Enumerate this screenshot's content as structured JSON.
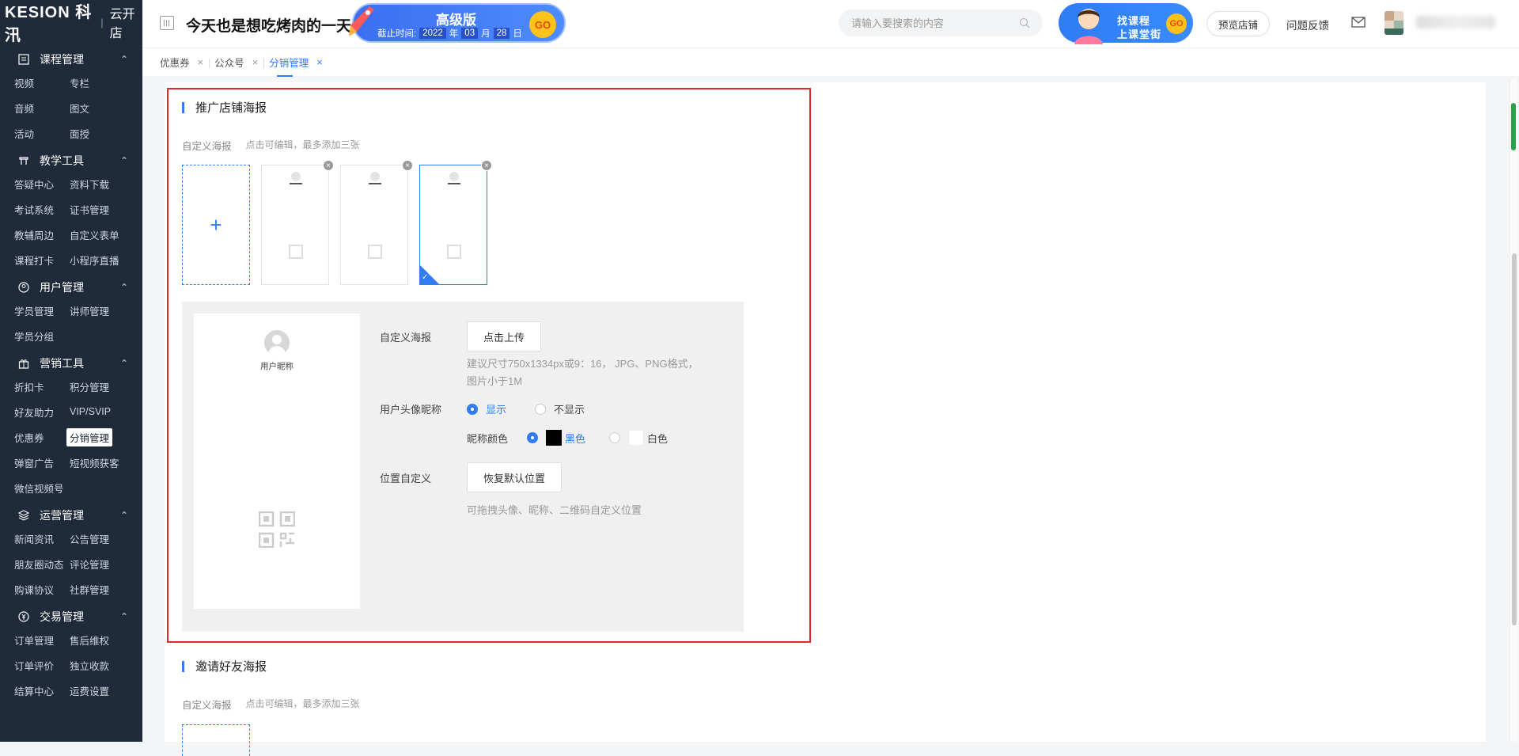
{
  "brand": {
    "name": "KESION 科汛",
    "shop": "云开店"
  },
  "header": {
    "slogan": "今天也是想吃烤肉的一天",
    "badge": {
      "level": "高级版",
      "expire_label": "截止时间:",
      "year": "2022",
      "year_unit": "年",
      "month": "03",
      "month_unit": "月",
      "day": "28",
      "day_unit": "日",
      "go": "GO"
    },
    "search_placeholder": "请输入要搜索的内容",
    "promo": {
      "line1": "找课程",
      "line2": "上课堂街",
      "go": "GO"
    },
    "preview_shop": "预览店铺",
    "feedback": "问题反馈"
  },
  "sidebar": {
    "groups": [
      {
        "title": "课程管理",
        "items": [
          "视频",
          "专栏",
          "音频",
          "图文",
          "活动",
          "面授"
        ]
      },
      {
        "title": "教学工具",
        "items": [
          "答疑中心",
          "资料下载",
          "考试系统",
          "证书管理",
          "教辅周边",
          "自定义表单",
          "课程打卡",
          "小程序直播"
        ]
      },
      {
        "title": "用户管理",
        "items": [
          "学员管理",
          "讲师管理",
          "学员分组"
        ]
      },
      {
        "title": "营销工具",
        "items": [
          "折扣卡",
          "积分管理",
          "好友助力",
          "VIP/SVIP",
          "优惠券",
          "分销管理",
          "弹窗广告",
          "短视频获客",
          "微信视频号"
        ]
      },
      {
        "title": "运营管理",
        "items": [
          "新闻资讯",
          "公告管理",
          "朋友圈动态",
          "评论管理",
          "购课协议",
          "社群管理"
        ]
      },
      {
        "title": "交易管理",
        "items": [
          "订单管理",
          "售后维权",
          "订单评价",
          "独立收款",
          "结算中心",
          "运费设置"
        ]
      }
    ]
  },
  "tabs": [
    {
      "label": "优惠券"
    },
    {
      "label": "公众号"
    },
    {
      "label": "分销管理"
    }
  ],
  "section1": {
    "title": "推广店铺海报",
    "custom_label": "自定义海报",
    "custom_hint": "点击可编辑，最多添加三张",
    "add_symbol": "+",
    "remove_symbol": "×",
    "preview_name": "用户昵称",
    "form": {
      "upload_label": "自定义海报",
      "upload_button": "点击上传",
      "upload_hint1": "建议尺寸750x1334px或9：16， JPG、PNG格式，",
      "upload_hint2": "图片小于1M",
      "avatar_label": "用户头像昵称",
      "show": "显示",
      "hide": "不显示",
      "color_label": "昵称颜色",
      "black": "黑色",
      "white": "白色",
      "position_label": "位置自定义",
      "reset_button": "恢复默认位置",
      "position_hint": "可拖拽头像、昵称、二维码自定义位置"
    }
  },
  "section2": {
    "title": "邀请好友海报",
    "custom_label": "自定义海报",
    "custom_hint": "点击可编辑，最多添加三张"
  },
  "colors": {
    "accent": "#2f7cf5",
    "sidebar_bg": "#1f2a3a",
    "highlight_border": "#e02a2a"
  }
}
